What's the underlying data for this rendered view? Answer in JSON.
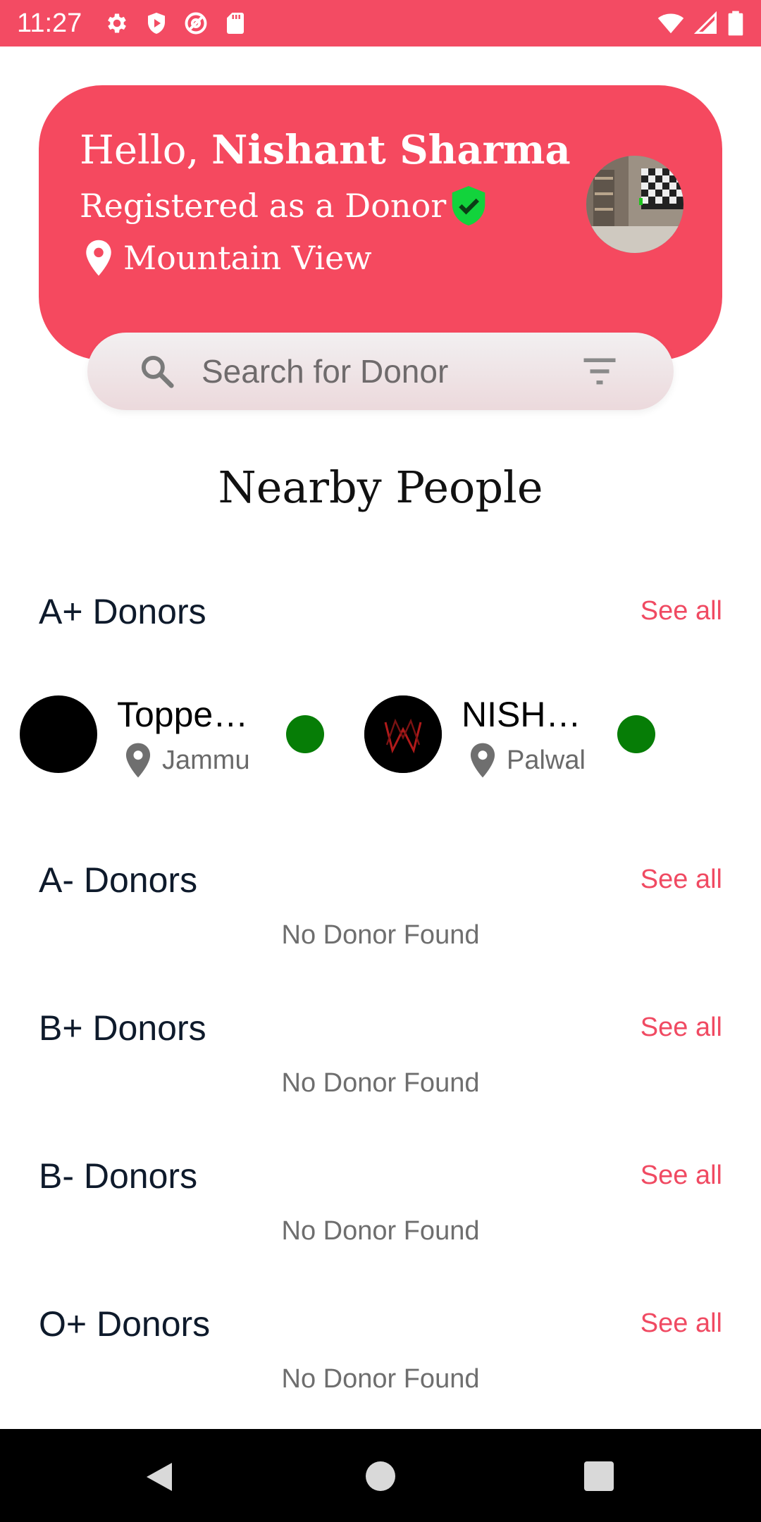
{
  "status_bar": {
    "time": "11:27",
    "background": "#f34b63",
    "left_icons": [
      "gear-icon",
      "shield-icon",
      "at-sign-icon",
      "sd-card-icon"
    ],
    "right_icons": [
      "wifi-icon",
      "cell-signal-icon",
      "battery-icon"
    ]
  },
  "header": {
    "greeting_prefix": "Hello, ",
    "user_name": "Nishant Sharma",
    "registered_text": "Registered as a Donor",
    "location": "Mountain View",
    "card_color": "#f5495f",
    "verified_color": "#12d33c"
  },
  "search": {
    "placeholder": "Search for Donor",
    "value": ""
  },
  "nearby_title": "Nearby People",
  "groups": [
    {
      "title": "A+ Donors",
      "see_all": "See all",
      "donors": [
        {
          "name": "Toppe…",
          "location": "Jammu",
          "online": true
        },
        {
          "name": "NISH…",
          "location": "Palwal",
          "online": true
        }
      ]
    },
    {
      "title": "A- Donors",
      "see_all": "See all",
      "empty_text": "No Donor Found"
    },
    {
      "title": "B+ Donors",
      "see_all": "See all",
      "empty_text": "No Donor Found"
    },
    {
      "title": "B- Donors",
      "see_all": "See all",
      "empty_text": "No Donor Found"
    },
    {
      "title": "O+ Donors",
      "see_all": "See all",
      "empty_text": "No Donor Found"
    }
  ],
  "colors": {
    "accent": "#f04a62",
    "online": "#067d06",
    "heading_text": "#0e1a2b"
  },
  "nav_bar": {
    "icons": [
      "back-icon",
      "home-icon",
      "recents-icon"
    ]
  }
}
